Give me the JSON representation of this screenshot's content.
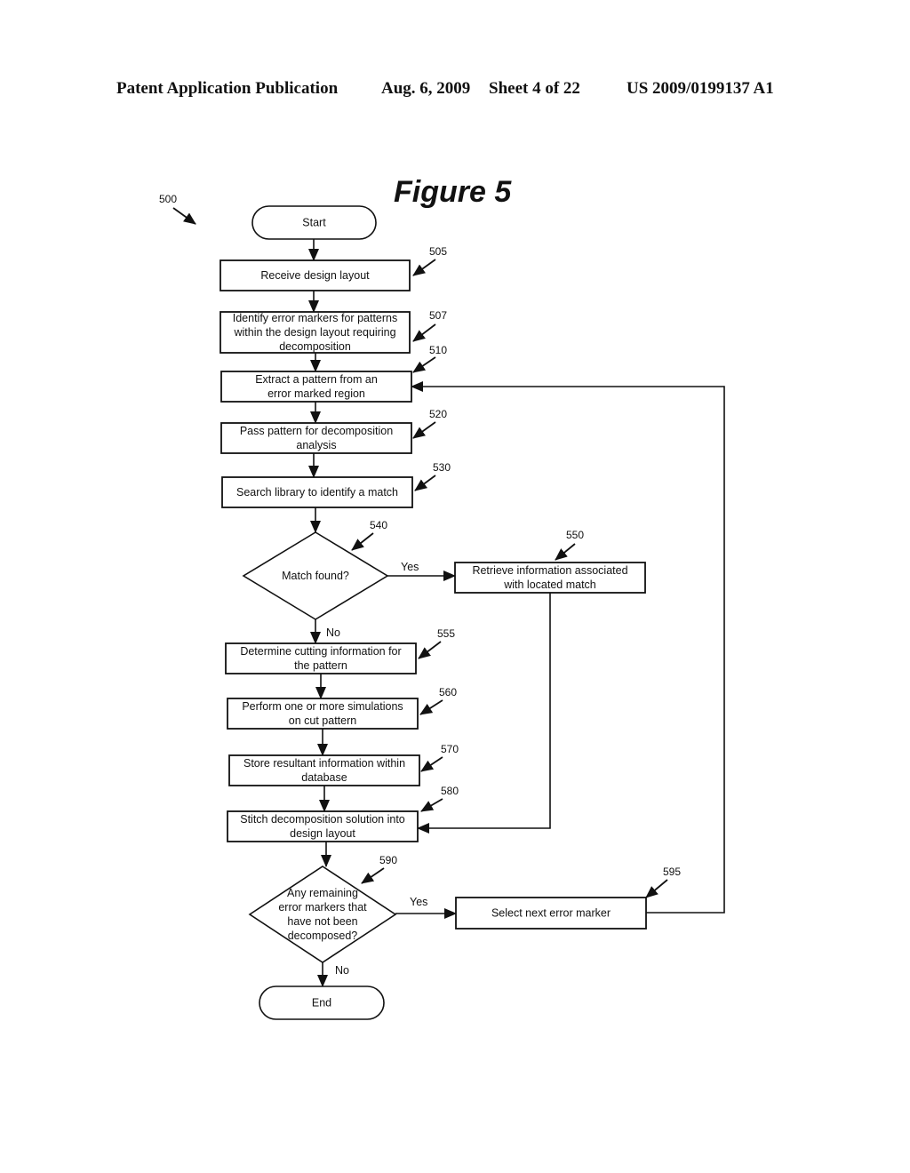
{
  "header": {
    "publication": "Patent Application Publication",
    "date": "Aug. 6, 2009",
    "sheet": "Sheet 4 of 22",
    "number": "US 2009/0199137 A1"
  },
  "figure": {
    "title": "Figure 5",
    "ref": "500"
  },
  "nodes": {
    "start": {
      "type": "terminal",
      "lines": [
        "Start"
      ]
    },
    "n505": {
      "type": "process",
      "ref": "505",
      "lines": [
        "Receive design layout"
      ]
    },
    "n507": {
      "type": "process",
      "ref": "507",
      "lines": [
        "Identify error markers for patterns",
        "within the design layout requiring",
        "decomposition"
      ]
    },
    "n510": {
      "type": "process",
      "ref": "510",
      "lines": [
        "Extract a pattern from an",
        "error marked region"
      ]
    },
    "n520": {
      "type": "process",
      "ref": "520",
      "lines": [
        "Pass pattern for decomposition",
        "analysis"
      ]
    },
    "n530": {
      "type": "process",
      "ref": "530",
      "lines": [
        "Search library to identify a match"
      ]
    },
    "n540": {
      "type": "decision",
      "ref": "540",
      "lines": [
        "Match found?"
      ]
    },
    "n550": {
      "type": "process",
      "ref": "550",
      "lines": [
        "Retrieve information associated",
        "with located match"
      ]
    },
    "n555": {
      "type": "process",
      "ref": "555",
      "lines": [
        "Determine cutting information for",
        "the pattern"
      ]
    },
    "n560": {
      "type": "process",
      "ref": "560",
      "lines": [
        "Perform one or more simulations",
        "on cut pattern"
      ]
    },
    "n570": {
      "type": "process",
      "ref": "570",
      "lines": [
        "Store resultant information within",
        "database"
      ]
    },
    "n580": {
      "type": "process",
      "ref": "580",
      "lines": [
        "Stitch decomposition solution into",
        "design layout"
      ]
    },
    "n590": {
      "type": "decision",
      "ref": "590",
      "lines": [
        "Any remaining",
        "error markers that",
        "have not been",
        "decomposed?"
      ]
    },
    "n595": {
      "type": "process",
      "ref": "595",
      "lines": [
        "Select next error marker"
      ]
    },
    "end": {
      "type": "terminal",
      "lines": [
        "End"
      ]
    }
  },
  "edge_labels": {
    "yes": "Yes",
    "no": "No"
  },
  "edges": [
    {
      "from": "start",
      "to": "n505"
    },
    {
      "from": "n505",
      "to": "n507"
    },
    {
      "from": "n507",
      "to": "n510"
    },
    {
      "from": "n510",
      "to": "n520"
    },
    {
      "from": "n520",
      "to": "n530"
    },
    {
      "from": "n530",
      "to": "n540"
    },
    {
      "from": "n540",
      "to": "n550",
      "label": "Yes"
    },
    {
      "from": "n540",
      "to": "n555",
      "label": "No"
    },
    {
      "from": "n555",
      "to": "n560"
    },
    {
      "from": "n560",
      "to": "n570"
    },
    {
      "from": "n570",
      "to": "n580"
    },
    {
      "from": "n550",
      "to": "n580"
    },
    {
      "from": "n580",
      "to": "n590"
    },
    {
      "from": "n590",
      "to": "n595",
      "label": "Yes"
    },
    {
      "from": "n590",
      "to": "end",
      "label": "No"
    },
    {
      "from": "n595",
      "to": "n510"
    }
  ]
}
